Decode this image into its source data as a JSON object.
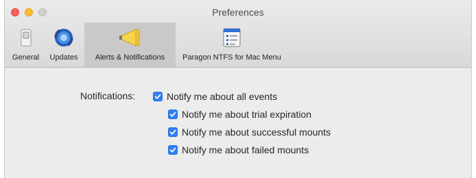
{
  "window": {
    "title": "Preferences"
  },
  "toolbar": {
    "items": [
      {
        "label": "General",
        "icon": "switch-icon",
        "selected": false
      },
      {
        "label": "Updates",
        "icon": "updates-icon",
        "selected": false
      },
      {
        "label": "Alerts & Notifications",
        "icon": "megaphone-icon",
        "selected": true
      },
      {
        "label": "Paragon NTFS for Mac Menu",
        "icon": "menu-window-icon",
        "selected": false
      }
    ]
  },
  "notifications": {
    "label": "Notifications:",
    "options": [
      {
        "label": "Notify me about all events",
        "checked": true
      },
      {
        "label": "Notify me about trial expiration",
        "checked": true
      },
      {
        "label": "Notify me about successful mounts",
        "checked": true
      },
      {
        "label": "Notify me about failed mounts",
        "checked": true
      }
    ]
  },
  "colors": {
    "checkbox_accent": "#2f7ff6",
    "close": "#fd5f57",
    "minimize": "#febc2e"
  }
}
